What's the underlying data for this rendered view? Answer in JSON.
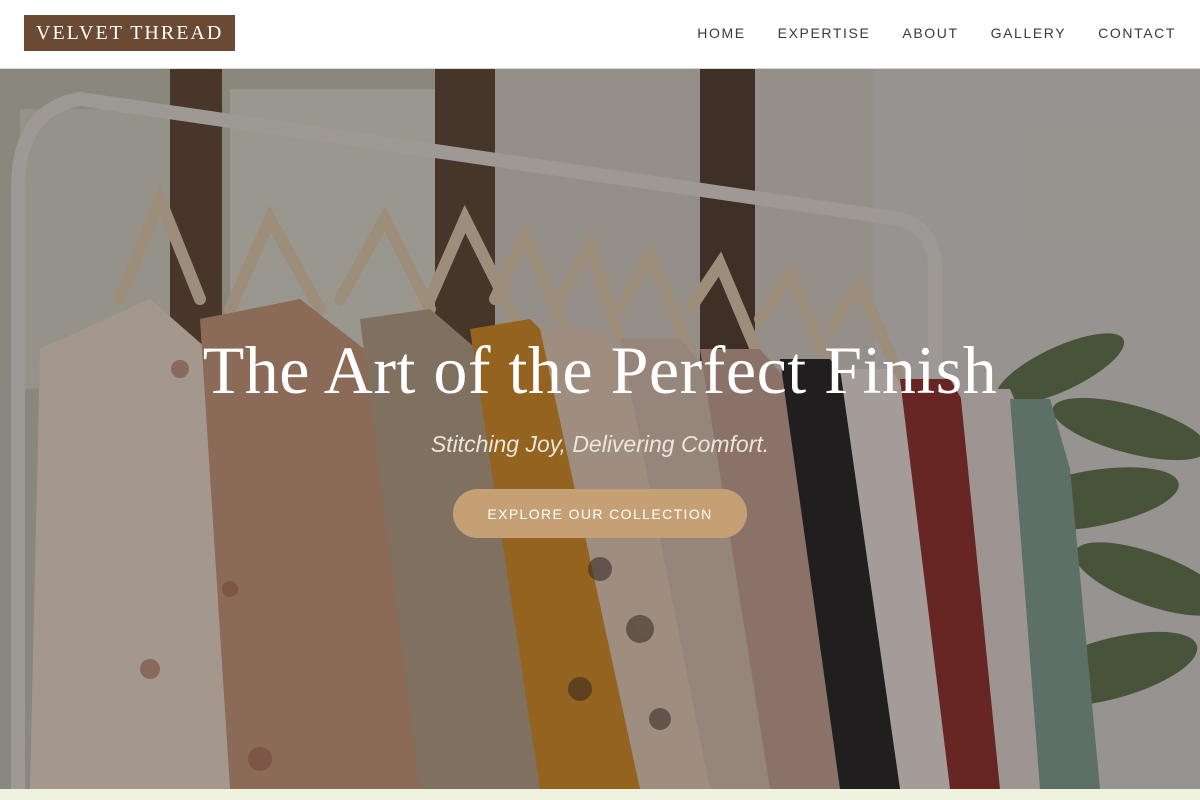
{
  "brand": {
    "name": "VELVET THREAD"
  },
  "nav": {
    "items": [
      {
        "label": "HOME"
      },
      {
        "label": "EXPERTISE"
      },
      {
        "label": "ABOUT"
      },
      {
        "label": "GALLERY"
      },
      {
        "label": "CONTACT"
      }
    ]
  },
  "hero": {
    "title": "The Art of the Perfect Finish",
    "subtitle": "Stitching Joy, Delivering Comfort.",
    "cta_label": "EXPLORE OUR COLLECTION",
    "background": "clothing-rack-photo"
  },
  "colors": {
    "logo_bg": "#6b4a34",
    "cta_bg": "#c5a074",
    "nav_text": "#3a3a3a"
  }
}
